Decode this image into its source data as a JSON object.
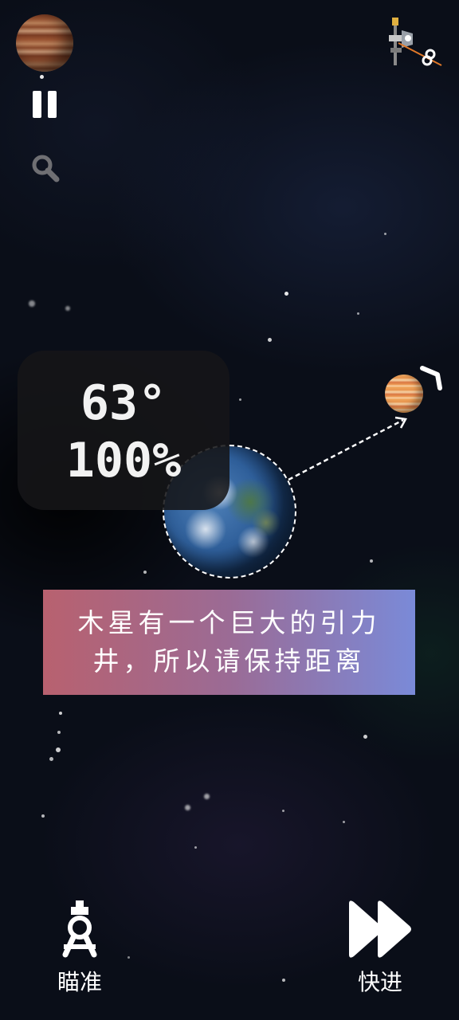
{
  "hud": {
    "angle": "63°",
    "power": "100%"
  },
  "hint": {
    "text": "木星有一个巨大的引力井，所以请保持距离"
  },
  "controls": {
    "aim_label": "瞄准",
    "fast_forward_label": "快进"
  },
  "icons": {
    "target_planet": "jupiter-icon",
    "pause": "pause-icon",
    "zoom": "magnifier-icon",
    "probe": "satellite-icon",
    "aim": "compass-icon",
    "fast_forward": "fast-forward-icon"
  },
  "colors": {
    "hint_gradient_start": "#b8616f",
    "hint_gradient_end": "#7a8ad8",
    "hud_background": "#161618"
  }
}
